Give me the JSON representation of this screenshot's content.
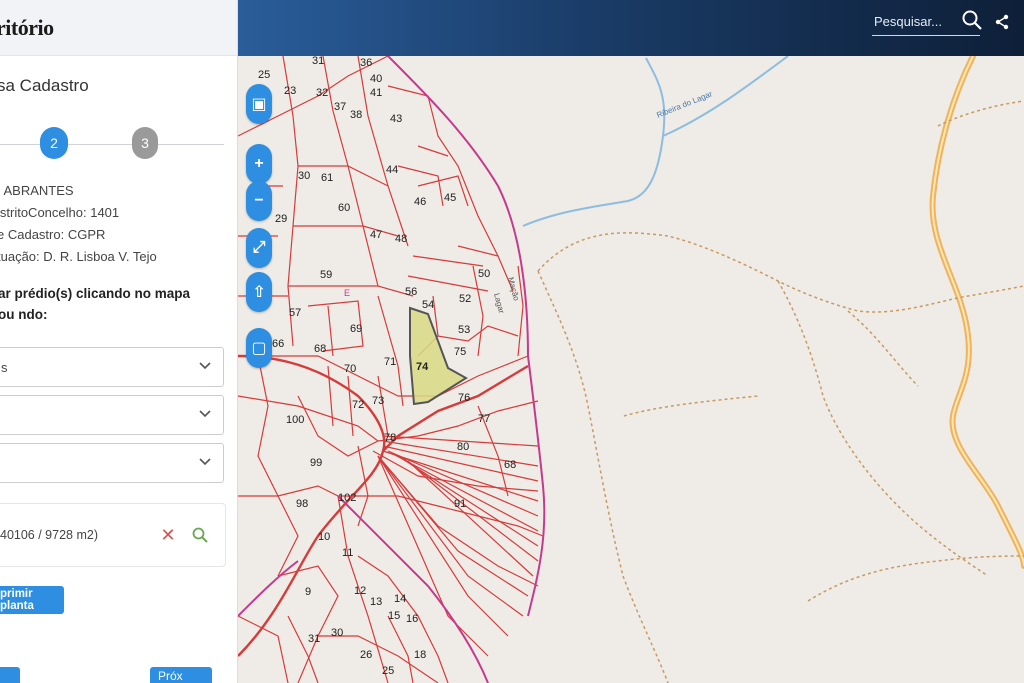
{
  "panel": {
    "title": "ritório",
    "subtitle": "sa Cadastro",
    "steps": [
      {
        "label": "2"
      },
      {
        "label": "3"
      }
    ],
    "info": [
      ": ABRANTES",
      "istritoConcelho: 1401",
      "e Cadastro: CGPR",
      "tuação: D. R. Lisboa V. Tejo"
    ],
    "instruction": "ar prédio(s) clicando no mapa ou ndo:",
    "selects": [
      {
        "value": "s"
      },
      {
        "value": ""
      },
      {
        "value": ""
      }
    ],
    "result": {
      "text": "40106 / 9728 m2)",
      "remove_label": "✕"
    },
    "print_label": "primir planta",
    "next_label": "Próx"
  },
  "topbar": {
    "search_placeholder": "Pesquisar...",
    "icons": [
      "search-icon",
      "share-icon"
    ]
  },
  "map": {
    "controls": [
      "image-icon",
      "zoom-in-icon",
      "zoom-out-icon",
      "fullscreen-icon",
      "north-arrow-icon",
      "extent-icon"
    ],
    "control_glyphs": [
      "▣",
      "+",
      "−",
      "⤢",
      "⇧",
      "▢"
    ],
    "stream_label": "Ribeira do Lagar",
    "road_label": "Mação",
    "road_label_2": "Lagar",
    "selected_plot": "74",
    "plot_labels": [
      "25",
      "31",
      "36",
      "40",
      "23",
      "32",
      "37",
      "41",
      "38",
      "43",
      "30",
      "61",
      "44",
      "45",
      "46",
      "60",
      "29",
      "47",
      "48",
      "50",
      "59",
      "56",
      "54",
      "52",
      "57",
      "53",
      "66",
      "68",
      "69",
      "71",
      "74",
      "75",
      "70",
      "72",
      "73",
      "76",
      "100",
      "77",
      "78",
      "80",
      "99",
      "68",
      "102",
      "91",
      "98",
      "10",
      "11",
      "12",
      "13",
      "14",
      "15",
      "16",
      "9",
      "31",
      "30",
      "26",
      "25",
      "18",
      "E"
    ],
    "colors": {
      "parcel_stroke": "#d63b3b",
      "boundary": "#c43a8f",
      "selected_fill": "#d8db82",
      "stream": "#8cbde0",
      "road": "#f0b35a",
      "trail": "#c79a62",
      "map_bg": "#efebe6"
    }
  }
}
